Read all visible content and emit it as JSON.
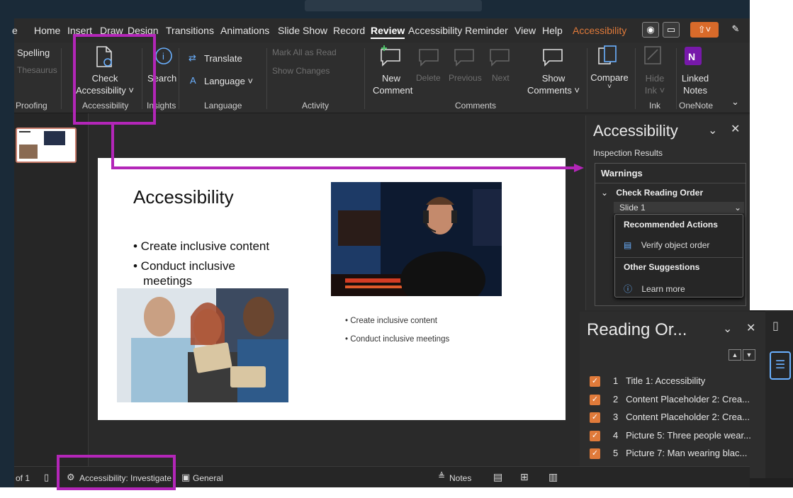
{
  "tabs": [
    "Home",
    "Insert",
    "Draw",
    "Design",
    "Transitions",
    "Animations",
    "Slide Show",
    "Record",
    "Review",
    "Accessibility Reminder",
    "View",
    "Help",
    "Accessibility"
  ],
  "ribbon": {
    "spelling": "Spelling",
    "thesaurus": "Thesaurus",
    "proofing": "Proofing",
    "check_line1": "Check",
    "check_line2": "Accessibility ˅",
    "accessibility_group": "Accessibility",
    "search": "Search",
    "insights": "Insights",
    "translate": "Translate",
    "language_btn": "Language ˅",
    "language_group": "Language",
    "mark_all_read": "Mark All as Read",
    "show_changes": "Show Changes",
    "activity_group": "Activity",
    "new_comment_1": "New",
    "new_comment_2": "Comment",
    "delete": "Delete",
    "previous": "Previous",
    "next": "Next",
    "show_comments_1": "Show",
    "show_comments_2": "Comments ˅",
    "comments_group": "Comments",
    "compare": "Compare",
    "hide_ink_1": "Hide",
    "hide_ink_2": "Ink ˅",
    "ink_group": "Ink",
    "linked_notes_1": "Linked",
    "linked_notes_2": "Notes",
    "onenote_group": "OneNote"
  },
  "slide": {
    "title": "Accessibility",
    "bullets": [
      "• Create inclusive content",
      "• Conduct inclusive",
      "meetings"
    ],
    "small_bullets": [
      "•  Create inclusive content",
      "•  Conduct inclusive meetings"
    ]
  },
  "accessibility_pane": {
    "title": "Accessibility",
    "subtitle": "Inspection Results",
    "warnings": "Warnings",
    "check_reading_order": "Check Reading Order",
    "slide_item": "Slide 1",
    "recommended_actions": "Recommended Actions",
    "verify_object_order": "Verify object order",
    "other_suggestions": "Other Suggestions",
    "learn_more": "Learn more"
  },
  "reading_order_pane": {
    "title": "Reading Or...",
    "items": [
      {
        "num": "1",
        "label": "Title 1: Accessibility"
      },
      {
        "num": "2",
        "label": "Content Placeholder 2: Crea..."
      },
      {
        "num": "3",
        "label": "Content Placeholder 2: Crea..."
      },
      {
        "num": "4",
        "label": "Picture 5: Three people wear..."
      },
      {
        "num": "5",
        "label": "Picture 7: Man wearing blac..."
      }
    ]
  },
  "status": {
    "slide_count": "of 1",
    "accessibility": "Accessibility: Investigate",
    "general": "General",
    "notes": "Notes"
  },
  "colors": {
    "highlight": "#b326b8",
    "accent": "#e07a3a"
  }
}
